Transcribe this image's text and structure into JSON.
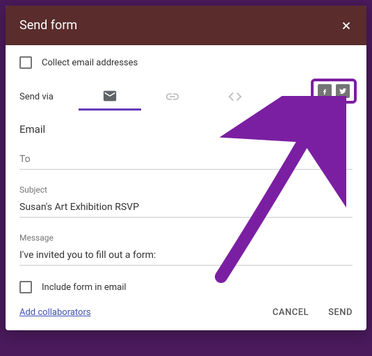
{
  "header": {
    "title": "Send form"
  },
  "collect": {
    "label": "Collect email addresses"
  },
  "sendvia": {
    "label": "Send via"
  },
  "email": {
    "section_label": "Email",
    "to_label": "To",
    "to_value": "",
    "subject_label": "Subject",
    "subject_value": "Susan's Art Exhibition RSVP",
    "message_label": "Message",
    "message_value": "I've invited you to fill out a form:"
  },
  "include": {
    "label": "Include form in email"
  },
  "footer": {
    "add_collab": "Add collaborators",
    "cancel": "CANCEL",
    "send": "SEND"
  }
}
